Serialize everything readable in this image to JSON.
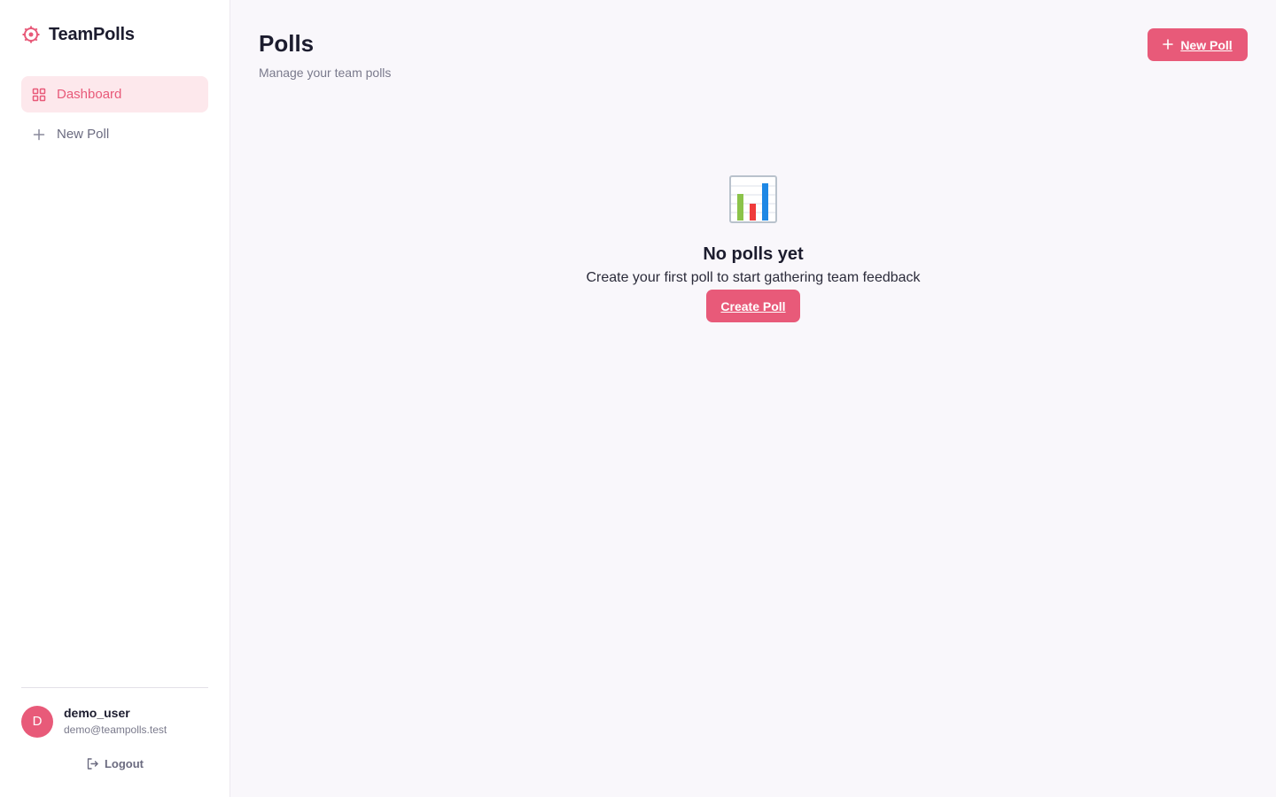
{
  "brand": {
    "name": "TeamPolls",
    "icon": "gear-icon",
    "accent": "#e85a79"
  },
  "sidebar": {
    "items": [
      {
        "label": "Dashboard",
        "icon": "grid-icon",
        "active": true
      },
      {
        "label": "New Poll",
        "icon": "plus-icon",
        "active": false
      }
    ]
  },
  "user": {
    "initial": "D",
    "name": "demo_user",
    "email": "demo@teampolls.test",
    "logout_label": "Logout"
  },
  "header": {
    "title": "Polls",
    "subtitle": "Manage your team polls",
    "new_poll_label": "New Poll"
  },
  "empty_state": {
    "icon": "bar-chart-icon",
    "title": "No polls yet",
    "text": "Create your first poll to start gathering team feedback",
    "button_label": "Create Poll"
  }
}
